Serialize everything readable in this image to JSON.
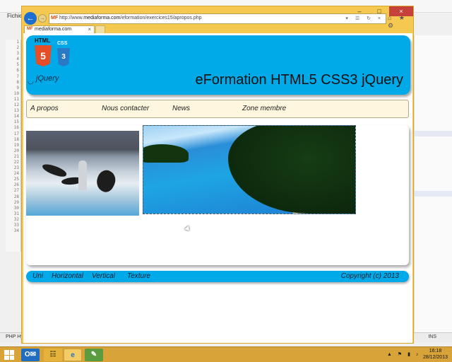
{
  "editor": {
    "menu_label": "Fichier",
    "line_numbers": "1\n2\n3\n4\n5\n6\n7\n8\n9\n10\n11\n12\n13\n14\n15\n16\n17\n18\n19\n20\n21\n22\n23\n24\n25\n26\n27\n28\n29\n30\n31\n32\n33\n34",
    "status_left": "PHP Hy",
    "status_right": "INS"
  },
  "browser": {
    "url_prefix": "http://www.",
    "url_domain": "mediaforma.com",
    "url_path": "/eformation/exercices15/apropos.php",
    "address_icons": "▾ ☰ ↻ ×",
    "toolbar_icons": "⌂ ★ ⚙",
    "favicon_text": "MF",
    "tab_title": "mediaforma.com",
    "tab_close": "×",
    "window_controls": {
      "min": "–",
      "max": "□",
      "close": "×"
    },
    "back_glyph": "←",
    "forward_glyph": "→"
  },
  "page": {
    "logo": {
      "html5_label": "HTML",
      "html5_number": "5",
      "css3_label": "CSS",
      "css3_number": "3",
      "jquery_text": "jQuery"
    },
    "title": "eFormation HTML5 CSS3 jQuery",
    "nav": [
      {
        "label": "A propos"
      },
      {
        "label": "Nous contacter"
      },
      {
        "label": "News"
      },
      {
        "label": "Zone membre"
      }
    ],
    "footer": {
      "links": [
        {
          "label": "Uni"
        },
        {
          "label": "Horizontal"
        },
        {
          "label": "Vertical"
        },
        {
          "label": "Texture"
        }
      ],
      "copyright": "Copyright (c) 2013"
    }
  },
  "taskbar": {
    "apps": {
      "outlook": "O✉",
      "explorer": "☷",
      "ie": "e",
      "notepad": "✎"
    },
    "tray_icons": "▲ ⚑ ▮ ♪",
    "time": "16:18",
    "date": "28/12/2013"
  }
}
